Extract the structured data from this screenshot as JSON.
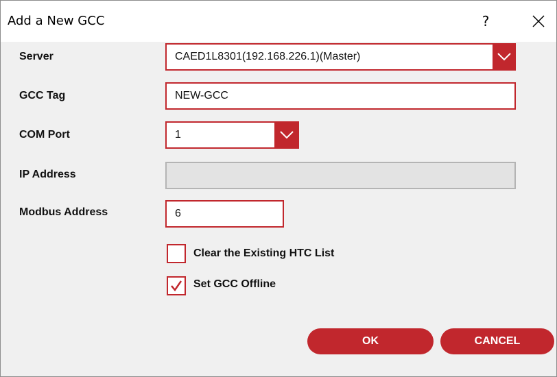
{
  "dialog": {
    "title": "Add a New GCC",
    "help_label": "?"
  },
  "form": {
    "server": {
      "label": "Server",
      "value": "CAED1L8301(192.168.226.1)(Master)"
    },
    "gcc_tag": {
      "label": "GCC Tag",
      "value": "NEW-GCC"
    },
    "com_port": {
      "label": "COM Port",
      "value": "1"
    },
    "ip_address": {
      "label": "IP Address",
      "value": ""
    },
    "modbus_address": {
      "label": "Modbus Address",
      "value": "6"
    },
    "clear_htc": {
      "label": "Clear the Existing HTC List",
      "checked": false
    },
    "set_offline": {
      "label": "Set GCC Offline",
      "checked": true
    }
  },
  "buttons": {
    "ok": "OK",
    "cancel": "CANCEL"
  },
  "colors": {
    "accent": "#c1272d",
    "dialog_bg": "#f0f0f0",
    "disabled_field": "#e3e3e3"
  },
  "icons": {
    "close": "close-icon",
    "dropdown": "chevron-down-icon",
    "check": "checkmark-icon"
  }
}
